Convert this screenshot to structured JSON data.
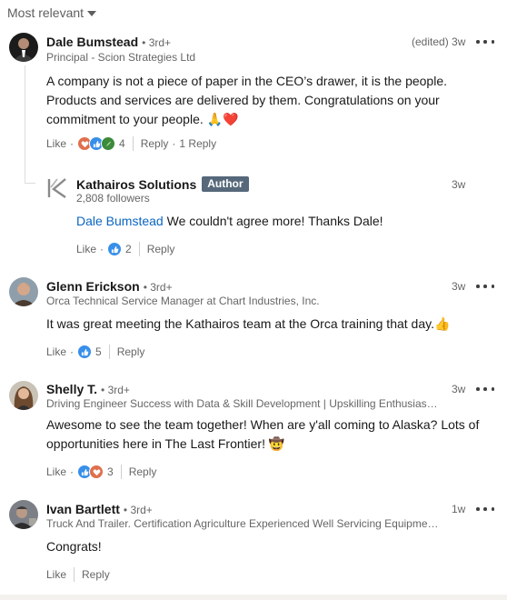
{
  "sort": {
    "label": "Most relevant"
  },
  "comments": [
    {
      "name": "Dale Bumstead",
      "degree": "• 3rd+",
      "subtitle": "Principal - Scion Strategies Ltd",
      "time": "(edited) 3w",
      "text": "A company is not a piece of paper in the CEO’s drawer, it is the people. Products and services are delivered by them. Congratulations on your commitment to your people. ",
      "emoji": "🙏❤️",
      "like": "Like",
      "dot": "·",
      "reaction_count": "4",
      "reply": "Reply",
      "reply_count": "1 Reply",
      "reply_dot": "·"
    },
    {
      "name": "Glenn Erickson",
      "degree": "• 3rd+",
      "subtitle": "Orca Technical Service Manager at Chart Industries, Inc.",
      "time": "3w",
      "text": "It was great meeting the Kathairos team at the Orca training that day.",
      "emoji": "👍",
      "like": "Like",
      "dot": "·",
      "reaction_count": "5",
      "reply": "Reply"
    },
    {
      "name": "Shelly T.",
      "degree": "• 3rd+",
      "subtitle": "Driving Engineer Success with Data & Skill Development | Upskilling Enthusiast |...",
      "time": "3w",
      "text": "Awesome to see the team together! When are y'all coming to Alaska? Lots of opportunities here in The Last Frontier! ",
      "emoji": "🤠",
      "like": "Like",
      "dot": "·",
      "reaction_count": "3",
      "reply": "Reply"
    },
    {
      "name": "Ivan Bartlett",
      "degree": "• 3rd+",
      "subtitle": "Truck And Trailer. Certification Agriculture Experienced Well Servicing Equipmen...",
      "time": "1w",
      "text": "Congrats!",
      "like": "Like",
      "reply": "Reply"
    }
  ],
  "reply": {
    "name": "Kathairos Solutions",
    "badge": "Author",
    "subtitle": "2,808 followers",
    "time": "3w",
    "mention": "Dale Bumstead",
    "text": " We couldn't agree more! Thanks Dale!",
    "like": "Like",
    "dot": "·",
    "reaction_count": "2",
    "reply": "Reply"
  },
  "colors": {
    "link": "#0a66c2",
    "author_badge": "#56687a",
    "like_icon": "#378fe9",
    "love_icon": "#df704d",
    "support_icon": "#3c8a3c"
  },
  "icons": {
    "sort_caret": "caret-down-icon",
    "more": "more-horizontal-icon",
    "like_reaction": "like-reaction-icon",
    "love_reaction": "love-reaction-icon",
    "support_reaction": "support-reaction-icon",
    "company_logo": "kathairos-logo-icon"
  }
}
